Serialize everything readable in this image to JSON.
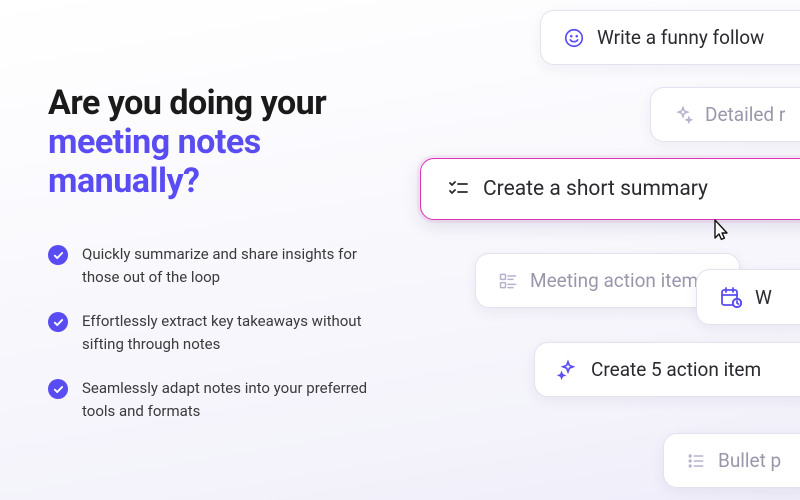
{
  "headline": {
    "part1": "Are you doing your",
    "accent": "meeting notes manually?"
  },
  "bullets": [
    "Quickly summarize and share insights for those out of the loop",
    "Effortlessly extract key takeaways without sifting through notes",
    "Seamlessly adapt notes into your preferred tools and formats"
  ],
  "pills": {
    "funny": "Write a funny follow",
    "detailed": "Detailed r",
    "summary": "Create a short summary",
    "meeting": "Meeting action items",
    "w": "W",
    "action5": "Create 5 action item",
    "bulletp": "Bullet p"
  },
  "colors": {
    "accent": "#5a4cf3",
    "activePillBorder": "#d935b5"
  }
}
